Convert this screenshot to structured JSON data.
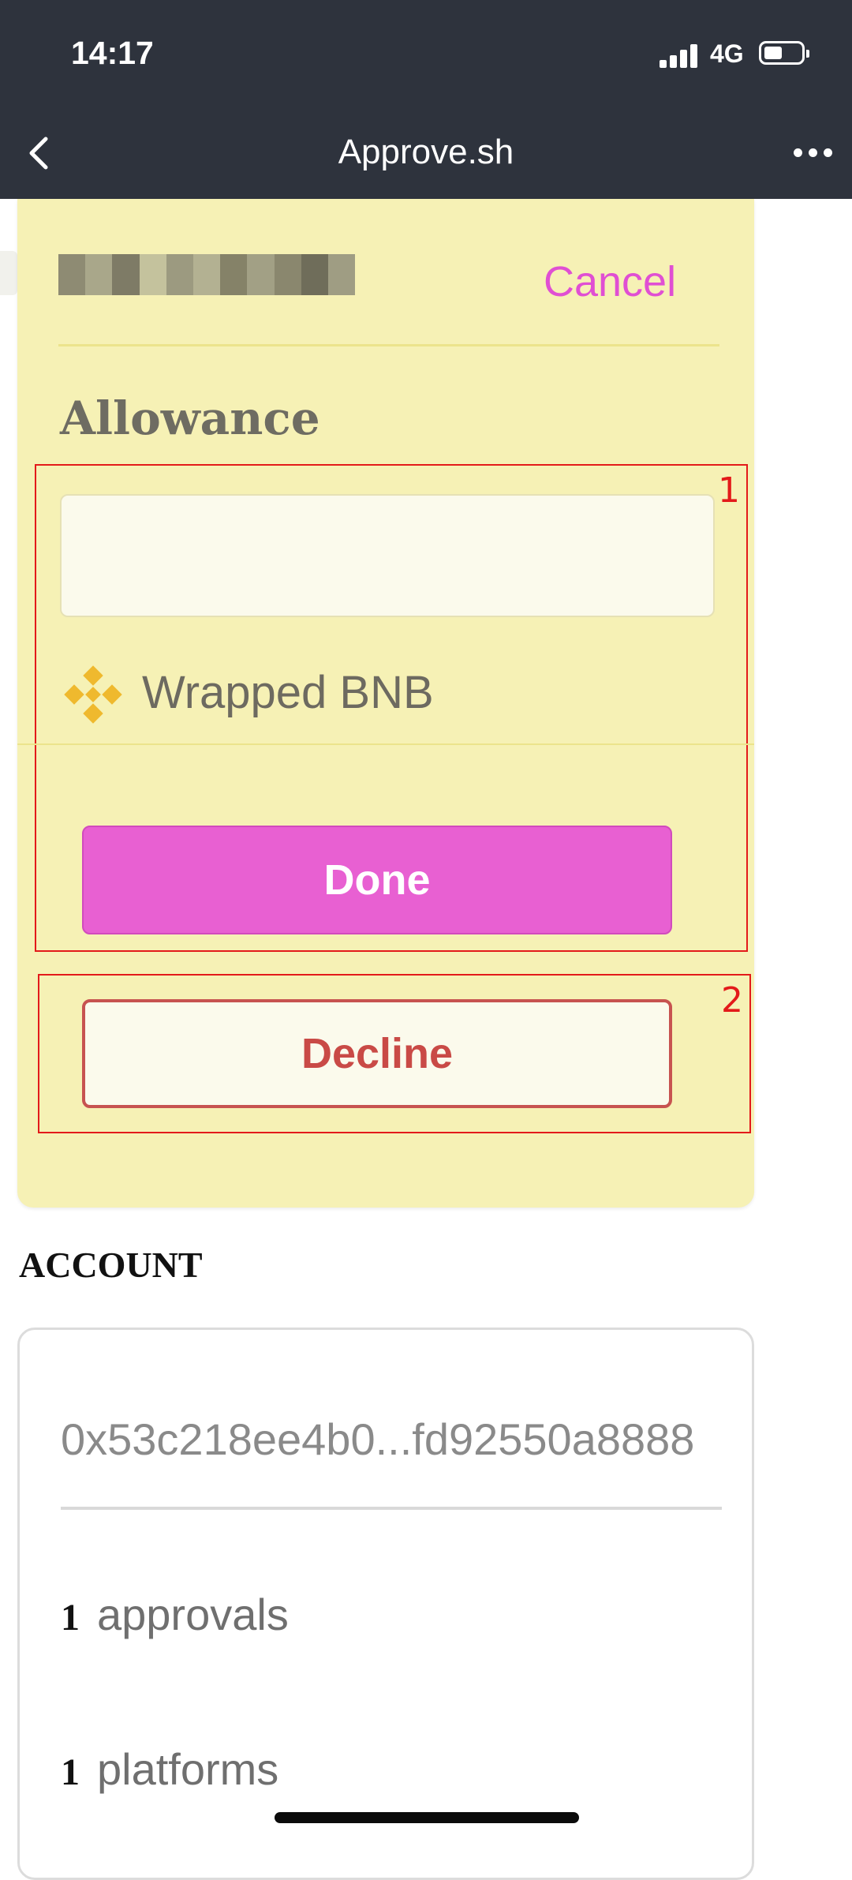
{
  "status_bar": {
    "time": "14:17",
    "network": "4G",
    "icons": [
      "signal-icon",
      "battery-icon"
    ]
  },
  "nav": {
    "title": "Approve.sh",
    "back_icon": "chevron-left-icon",
    "more_icon": "more-dots-icon"
  },
  "dialog": {
    "cancel_label": "Cancel",
    "section_title": "Allowance",
    "allowance_value": "",
    "token_name": "Wrapped BNB",
    "token_icon": "bnb-icon",
    "done_label": "Done",
    "decline_label": "Decline",
    "annotations": [
      "1",
      "2"
    ],
    "colors": {
      "card_bg": "#f6f1b5",
      "accent_pink": "#e860d2",
      "decline_red": "#c94a46",
      "annotation_red": "#e31a1a"
    }
  },
  "account": {
    "heading": "ACCOUNT",
    "address": "0x53c218ee4b0...fd92550a8888",
    "stats": [
      {
        "value": "1",
        "label": "approvals"
      },
      {
        "value": "1",
        "label": "platforms"
      }
    ]
  }
}
